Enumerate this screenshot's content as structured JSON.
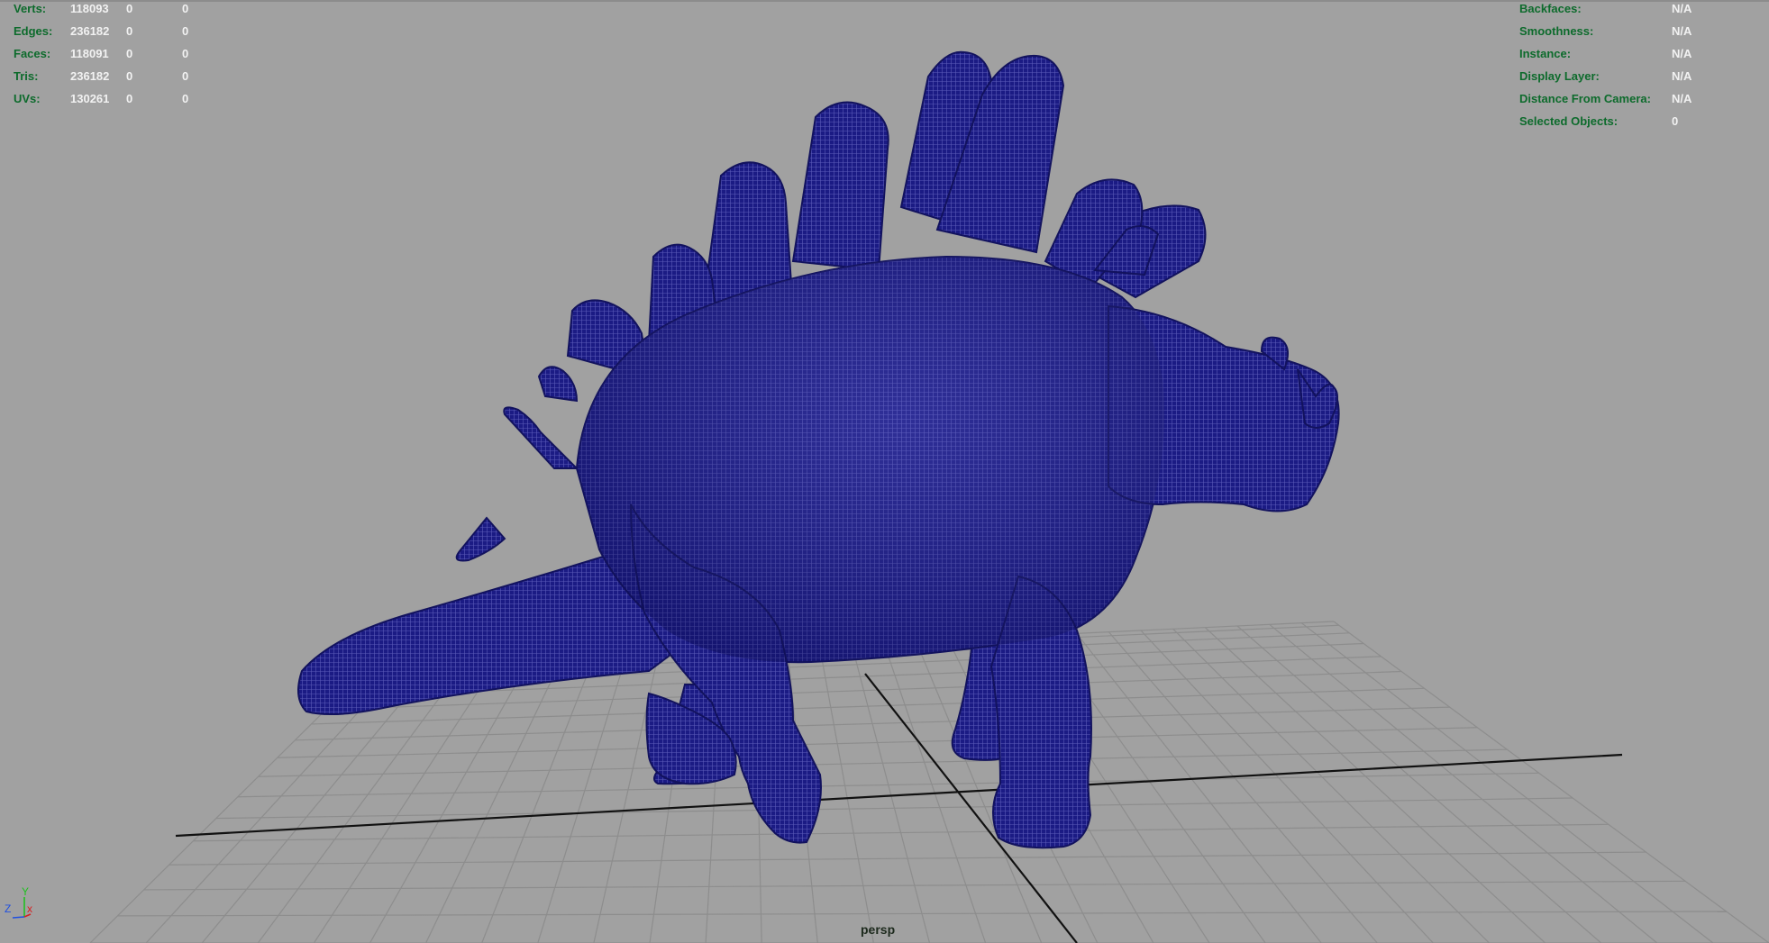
{
  "viewport": {
    "camera": "persp",
    "background_color": "#a1a1a1",
    "mesh_color": "#1a1a82",
    "grid_color": "#8d8d8d",
    "axis_color": "#111111",
    "label_color": "#0d6b2c",
    "value_color": "#f2f2f2"
  },
  "hud_left": {
    "rows": [
      {
        "label": "Verts:",
        "v1": "118093",
        "v2": "0",
        "v3": "0"
      },
      {
        "label": "Edges:",
        "v1": "236182",
        "v2": "0",
        "v3": "0"
      },
      {
        "label": "Faces:",
        "v1": "118091",
        "v2": "0",
        "v3": "0"
      },
      {
        "label": "Tris:",
        "v1": "236182",
        "v2": "0",
        "v3": "0"
      },
      {
        "label": "UVs:",
        "v1": "130261",
        "v2": "0",
        "v3": "0"
      }
    ]
  },
  "hud_right": {
    "rows": [
      {
        "label": "Backfaces:",
        "value": "N/A"
      },
      {
        "label": "Smoothness:",
        "value": "N/A"
      },
      {
        "label": "Instance:",
        "value": "N/A"
      },
      {
        "label": "Display Layer:",
        "value": "N/A"
      },
      {
        "label": "Distance From Camera:",
        "value": "N/A"
      },
      {
        "label": "Selected Objects:",
        "value": "0"
      }
    ]
  },
  "axis_gizmo": {
    "x_label": "x",
    "y_label": "Y",
    "z_label": "Z",
    "x_color": "#d82020",
    "y_color": "#20c020",
    "z_color": "#2050e0"
  },
  "model": {
    "icon": "stegosaurus-mesh-icon"
  }
}
